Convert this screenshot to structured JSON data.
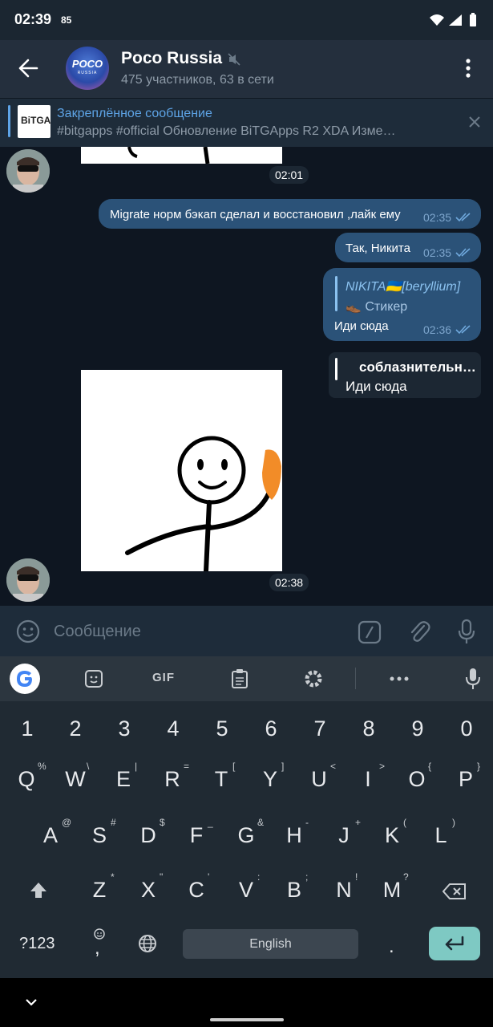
{
  "status": {
    "time": "02:39",
    "battery_pct": "85"
  },
  "header": {
    "title": "Poco Russia",
    "subtitle": "475 участников, 63 в сети",
    "avatar_logo": "POCO",
    "avatar_sub": "RUSSIA"
  },
  "pinned": {
    "title": "Закреплённое сообщение",
    "text": "#bitgapps #official  Обновление BiTGApps R2  XDA  Изме…",
    "thumb_label": "BiTGA"
  },
  "messages": [
    {
      "id": "m1",
      "type": "sticker-partial",
      "time": "02:01"
    },
    {
      "id": "m2",
      "type": "out",
      "text": "Migrate норм бэкап сделал и восстановил ,лайк ему",
      "time": "02:35"
    },
    {
      "id": "m3",
      "type": "out",
      "text": "Так, Никита",
      "time": "02:35"
    },
    {
      "id": "m4",
      "type": "out-reply",
      "reply_author": "NIKITA🇺🇦[beryllium]",
      "reply_text": "👞 Стикер",
      "text": "Иди сюда",
      "time": "02:36"
    },
    {
      "id": "m5",
      "type": "reply-incoming",
      "reply_author": "соблазнительн…",
      "text": "Иди сюда"
    },
    {
      "id": "m6",
      "type": "sticker",
      "time": "02:38"
    }
  ],
  "input": {
    "placeholder": "Сообщение"
  },
  "keyboard": {
    "toolbar": [
      "G",
      "sticker",
      "GIF",
      "clipboard",
      "settings",
      "more",
      "mic"
    ],
    "gif_label": "GIF",
    "row_numbers": [
      "1",
      "2",
      "3",
      "4",
      "5",
      "6",
      "7",
      "8",
      "9",
      "0"
    ],
    "row1": [
      {
        "k": "Q",
        "h": "%"
      },
      {
        "k": "W",
        "h": "\\"
      },
      {
        "k": "E",
        "h": "|"
      },
      {
        "k": "R",
        "h": "="
      },
      {
        "k": "T",
        "h": "["
      },
      {
        "k": "Y",
        "h": "]"
      },
      {
        "k": "U",
        "h": "<"
      },
      {
        "k": "I",
        "h": ">"
      },
      {
        "k": "O",
        "h": "{"
      },
      {
        "k": "P",
        "h": "}"
      }
    ],
    "row2": [
      {
        "k": "A",
        "h": "@"
      },
      {
        "k": "S",
        "h": "#"
      },
      {
        "k": "D",
        "h": "$"
      },
      {
        "k": "F",
        "h": "_"
      },
      {
        "k": "G",
        "h": "&"
      },
      {
        "k": "H",
        "h": "-"
      },
      {
        "k": "J",
        "h": "+"
      },
      {
        "k": "K",
        "h": "("
      },
      {
        "k": "L",
        "h": ")"
      }
    ],
    "row3": [
      {
        "k": "Z",
        "h": "*"
      },
      {
        "k": "X",
        "h": "\""
      },
      {
        "k": "C",
        "h": "'"
      },
      {
        "k": "V",
        "h": ":"
      },
      {
        "k": "B",
        "h": ";"
      },
      {
        "k": "N",
        "h": "!"
      },
      {
        "k": "M",
        "h": "?"
      }
    ],
    "symbols_label": "?123",
    "comma": ",",
    "space_label": "English",
    "period": "."
  }
}
